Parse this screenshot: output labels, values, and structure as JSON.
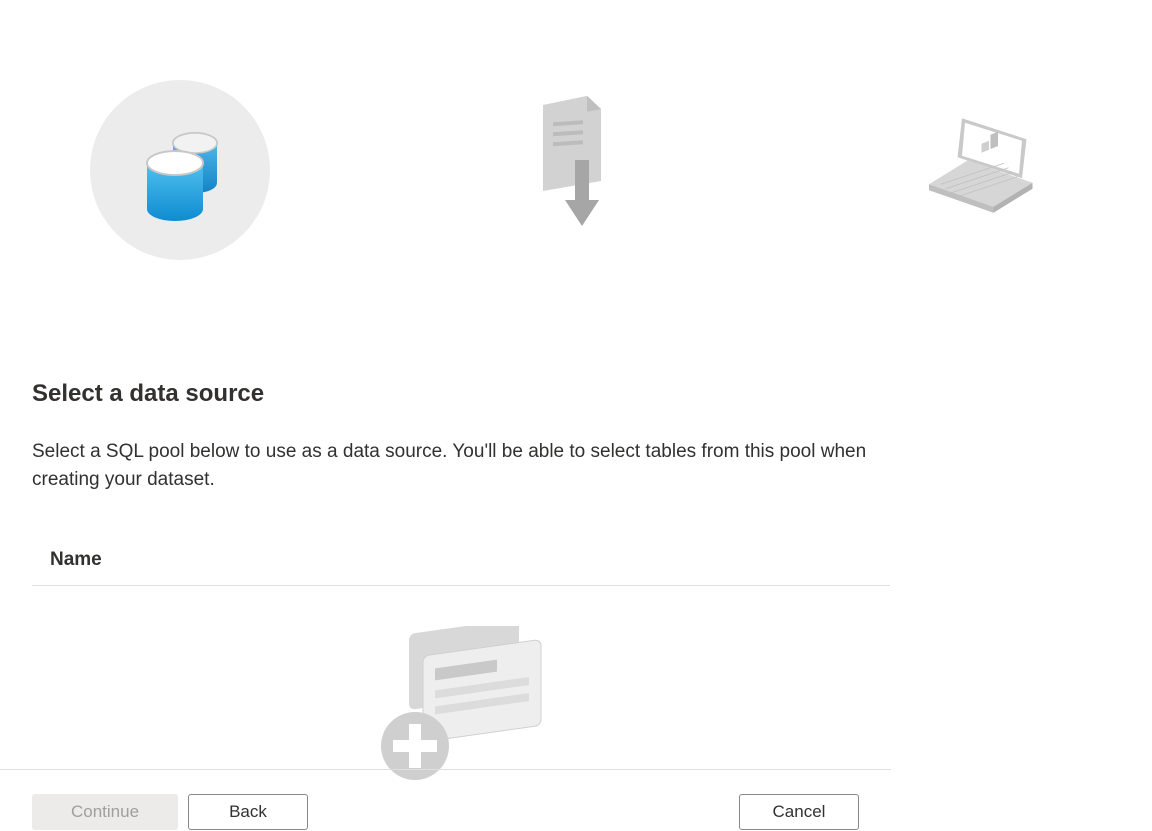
{
  "section": {
    "title": "Select a data source",
    "description": "Select a SQL pool below to use as a data source. You'll be able to select tables from this pool when creating your dataset."
  },
  "table": {
    "header_name": "Name"
  },
  "buttons": {
    "continue": "Continue",
    "back": "Back",
    "cancel": "Cancel"
  },
  "steps": {
    "step1_icon": "database-stack-icon",
    "step2_icon": "file-download-icon",
    "step3_icon": "laptop-report-icon"
  }
}
